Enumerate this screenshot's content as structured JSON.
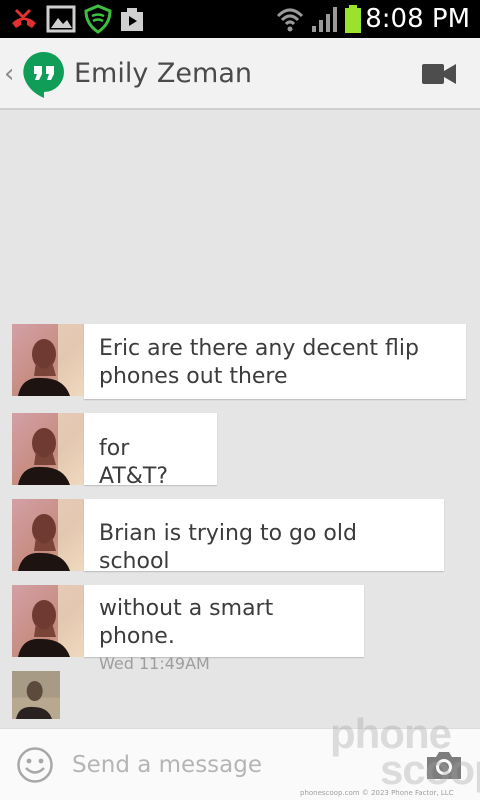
{
  "status_bar": {
    "time": "8:08 PM",
    "icons": [
      "missed-call-icon",
      "gallery-icon",
      "lookout-shield-icon",
      "play-store-icon",
      "wifi-icon",
      "signal-icon",
      "battery-icon"
    ]
  },
  "header": {
    "back_glyph": "‹",
    "app_icon": "hangouts-icon",
    "contact_name": "Emily Zeman",
    "action_icon": "video-camera-icon"
  },
  "messages": [
    {
      "line1": "Eric are there any decent flip",
      "line2": "phones out there",
      "time": ""
    },
    {
      "line1": "for AT&T?",
      "line2": "",
      "time": ""
    },
    {
      "line1": "Brian is trying to go old school",
      "line2": "",
      "time": ""
    },
    {
      "line1": "without a smart phone.",
      "line2": "",
      "time": "Wed 11:49AM"
    }
  ],
  "composer": {
    "placeholder": "Send a message",
    "left_icon": "emoji-icon",
    "right_icon": "camera-icon"
  },
  "watermark": {
    "line1": "phone",
    "line2": "scoop",
    "footer": "phonescoop.com   © 2023 Phone Factor, LLC"
  },
  "colors": {
    "status_bg": "#000000",
    "header_bg": "#f2f2f2",
    "chat_bg": "#e5e5e5",
    "hangouts_green": "#0f9d58",
    "battery_green": "#9be22d"
  }
}
